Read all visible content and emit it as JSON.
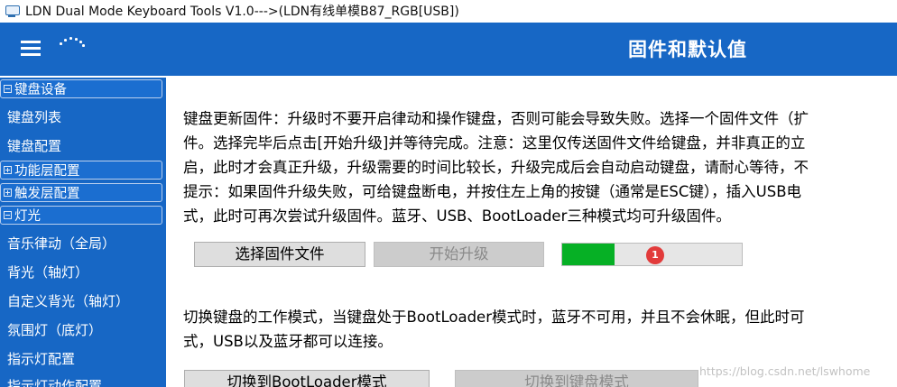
{
  "window": {
    "title": "LDN Dual Mode Keyboard Tools V1.0--->(LDN有线单模B87_RGB[USB])"
  },
  "header": {
    "title": "固件和默认值"
  },
  "sidebar": {
    "keyboard_group": "键盘设备",
    "keyboard_list": "键盘列表",
    "keyboard_config": "键盘配置",
    "function_layer_group": "功能层配置",
    "trigger_layer_group": "触发层配置",
    "lighting_group": "灯光",
    "music_rhythm": "音乐律动（全局）",
    "backlight_axis": "背光（轴灯）",
    "custom_backlight": "自定义背光（轴灯）",
    "ambient_light": "氛围灯（底灯）",
    "indicator_config": "指示灯配置",
    "indicator_action": "指示灯动作配置"
  },
  "main": {
    "firmware_text": [
      "键盘更新固件：升级时不要开启律动和操作键盘，否则可能会导致失败。选择一个固件文件（扩",
      "件。选择完毕后点击[开始升级]并等待完成。注意：这里仅传送固件文件给键盘，并非真正的立",
      "启，此时才会真正升级，升级需要的时间比较长，升级完成后会自动启动键盘，请耐心等待，不",
      "提示：如果固件升级失败，可给键盘断电，并按住左上角的按键（通常是ESC键），插入USB电",
      "式，此时可再次尝试升级固件。蓝牙、USB、BootLoader三种模式均可升级固件。"
    ],
    "select_firmware_button": "选择固件文件",
    "start_upgrade_button": "开始升级",
    "progress": 0.29,
    "progress_color": "#06b025",
    "badge_count": "1",
    "mode_text": [
      "切换键盘的工作模式，当键盘处于BootLoader模式时，蓝牙不可用，并且不会休眠，但此时可",
      "式，USB以及蓝牙都可以连接。"
    ],
    "switch_bootloader_button": "切换到BootLoader模式",
    "switch_keyboard_button": "切换到键盘模式"
  },
  "watermark": "https://blog.csdn.net/lswhome",
  "colors": {
    "accent": "#1767c5"
  }
}
